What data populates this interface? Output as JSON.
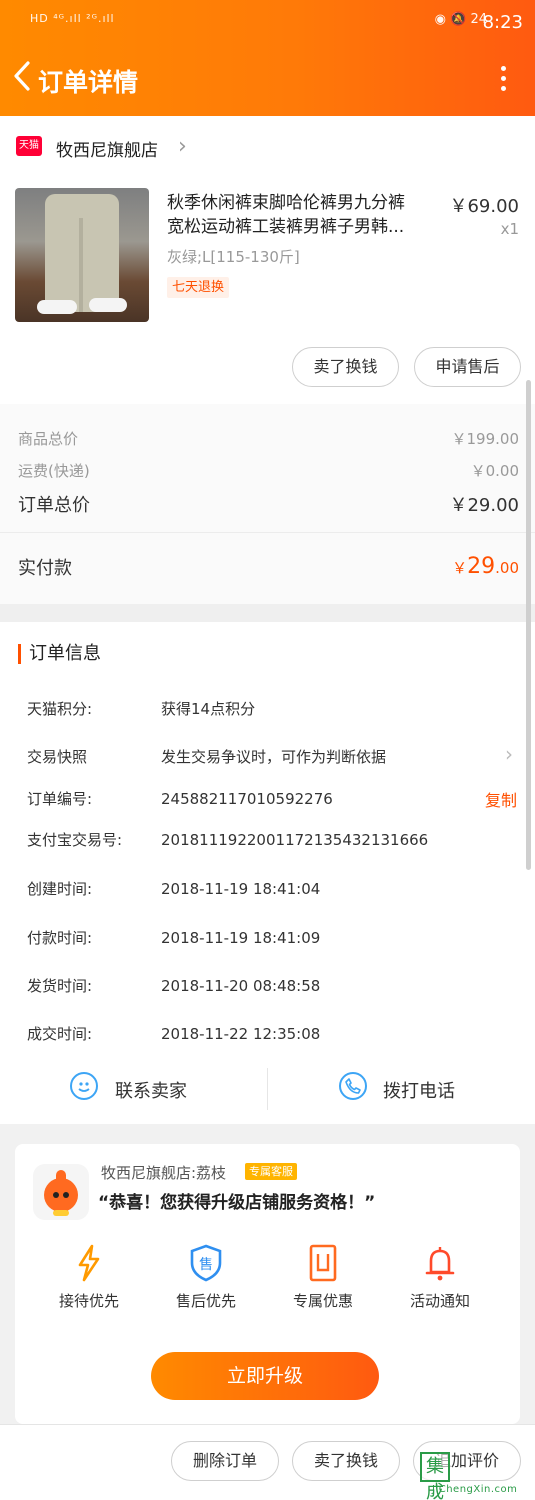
{
  "status_bar": {
    "left_indicators": "HD ⁴ᴳ.ıll ²ᴳ.ıll",
    "right_indicators": "◉ 🔕 24",
    "time": "8:23"
  },
  "nav": {
    "title": "订单详情",
    "back_icon": "chevron-left-icon",
    "more_icon": "more-vertical-icon"
  },
  "shop": {
    "badge": "天猫",
    "name": "牧西尼旗舰店"
  },
  "product": {
    "title_line1": "秋季休闲裤束脚哈伦裤男九分裤",
    "title_line2": "宽松运动裤工装裤男裤子男韩...",
    "price": "￥69.00",
    "quantity": "x1",
    "sku": "灰绿;L[115-130斤]",
    "tag": "七天退换",
    "buttons": {
      "sell": "卖了换钱",
      "after_sale": "申请售后"
    }
  },
  "totals": {
    "goods_label": "商品总价",
    "goods_value": "￥199.00",
    "shipping_label": "运费(快递)",
    "shipping_value": "￥0.00",
    "order_label": "订单总价",
    "order_value": "￥29.00",
    "paid_label": "实付款",
    "paid_symbol": "￥",
    "paid_integer": "29",
    "paid_decimal": ".00",
    "accent": "#ff5000"
  },
  "order_info": {
    "heading": "订单信息",
    "rows": [
      {
        "label": "天猫积分:",
        "value": "获得14点积分"
      },
      {
        "label": "交易快照",
        "value": "发生交易争议时，可作为判断依据"
      },
      {
        "label": "订单编号:",
        "value": "245882117010592276",
        "action": "复制"
      },
      {
        "label": "支付宝交易号:",
        "value": "2018111922001172135432131666"
      },
      {
        "label": "创建时间:",
        "value": "2018-11-19 18:41:04"
      },
      {
        "label": "付款时间:",
        "value": "2018-11-19 18:41:09"
      },
      {
        "label": "发货时间:",
        "value": "2018-11-20 08:48:58"
      },
      {
        "label": "成交时间:",
        "value": "2018-11-22 12:35:08"
      }
    ]
  },
  "contact": {
    "seller": "联系卖家",
    "phone": "拨打电话"
  },
  "vip": {
    "name": "牧西尼旗舰店:荔枝",
    "badge": "专属客服",
    "message": "“恭喜！您获得升级店铺服务资格！”",
    "perks": [
      {
        "label": "接待优先",
        "icon": "lightning-icon"
      },
      {
        "label": "售后优先",
        "icon": "shield-icon"
      },
      {
        "label": "专属优惠",
        "icon": "coupon-icon"
      },
      {
        "label": "活动通知",
        "icon": "bell-icon"
      }
    ],
    "upgrade_button": "立即升级"
  },
  "bottom_bar": {
    "delete": "删除订单",
    "sell": "卖了换钱",
    "review": "追加评价"
  },
  "watermark": {
    "text": "集成网",
    "url": "JiChengXin.com"
  }
}
